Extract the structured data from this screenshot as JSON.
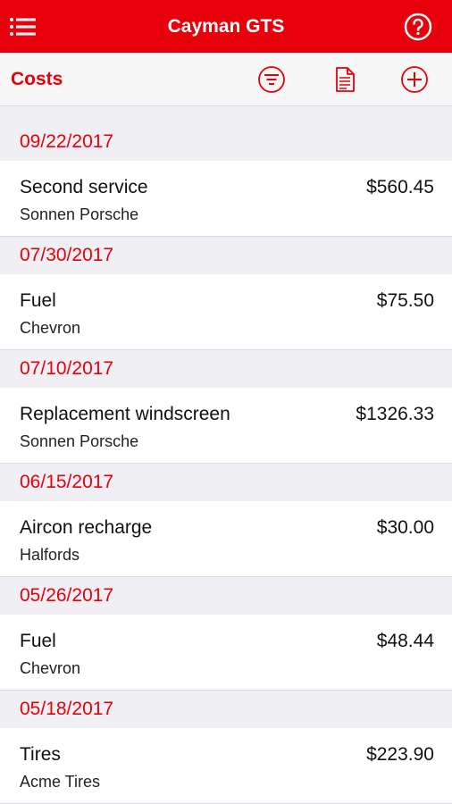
{
  "header": {
    "title": "Cayman GTS"
  },
  "toolbar": {
    "label": "Costs"
  },
  "icons": {
    "menu": "hamburger-menu-icon",
    "help": "question-circle-icon",
    "filter": "filter-circle-icon",
    "report": "document-icon",
    "add": "plus-circle-icon"
  },
  "colors": {
    "accent": "#e8000b",
    "background": "#efeff4"
  },
  "entries": [
    {
      "date": "09/22/2017",
      "name": "Second service",
      "vendor": "Sonnen Porsche",
      "amount": "$560.45"
    },
    {
      "date": "07/30/2017",
      "name": "Fuel",
      "vendor": "Chevron",
      "amount": "$75.50"
    },
    {
      "date": "07/10/2017",
      "name": "Replacement windscreen",
      "vendor": "Sonnen Porsche",
      "amount": "$1326.33"
    },
    {
      "date": "06/15/2017",
      "name": "Aircon recharge",
      "vendor": "Halfords",
      "amount": "$30.00"
    },
    {
      "date": "05/26/2017",
      "name": "Fuel",
      "vendor": "Chevron",
      "amount": "$48.44"
    },
    {
      "date": "05/18/2017",
      "name": "Tires",
      "vendor": "Acme Tires",
      "amount": "$223.90"
    }
  ]
}
